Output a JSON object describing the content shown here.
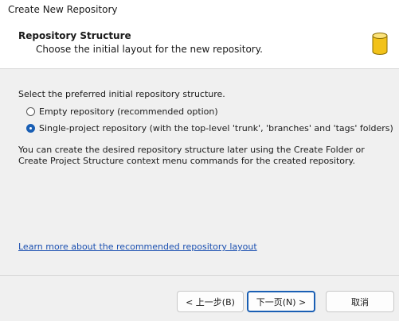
{
  "window": {
    "title": "Create New Repository"
  },
  "header": {
    "title": "Repository Structure",
    "subtitle": "Choose the initial layout for the new repository.",
    "icon": "database-icon"
  },
  "content": {
    "intro": "Select the preferred initial repository structure.",
    "options": [
      {
        "label": "Empty repository (recommended option)",
        "selected": false
      },
      {
        "label": "Single-project repository (with the top-level 'trunk', 'branches' and 'tags' folders)",
        "selected": true
      }
    ],
    "note": "You can create the desired repository structure later using the Create Folder or Create Project Structure context menu commands for the created repository.",
    "link": "Learn more about the recommended repository layout"
  },
  "buttons": {
    "back": "< 上一步(B)",
    "next": "下一页(N) >",
    "cancel": "取消"
  },
  "colors": {
    "accent": "#1a5fb4",
    "link": "#1a4fb0"
  }
}
